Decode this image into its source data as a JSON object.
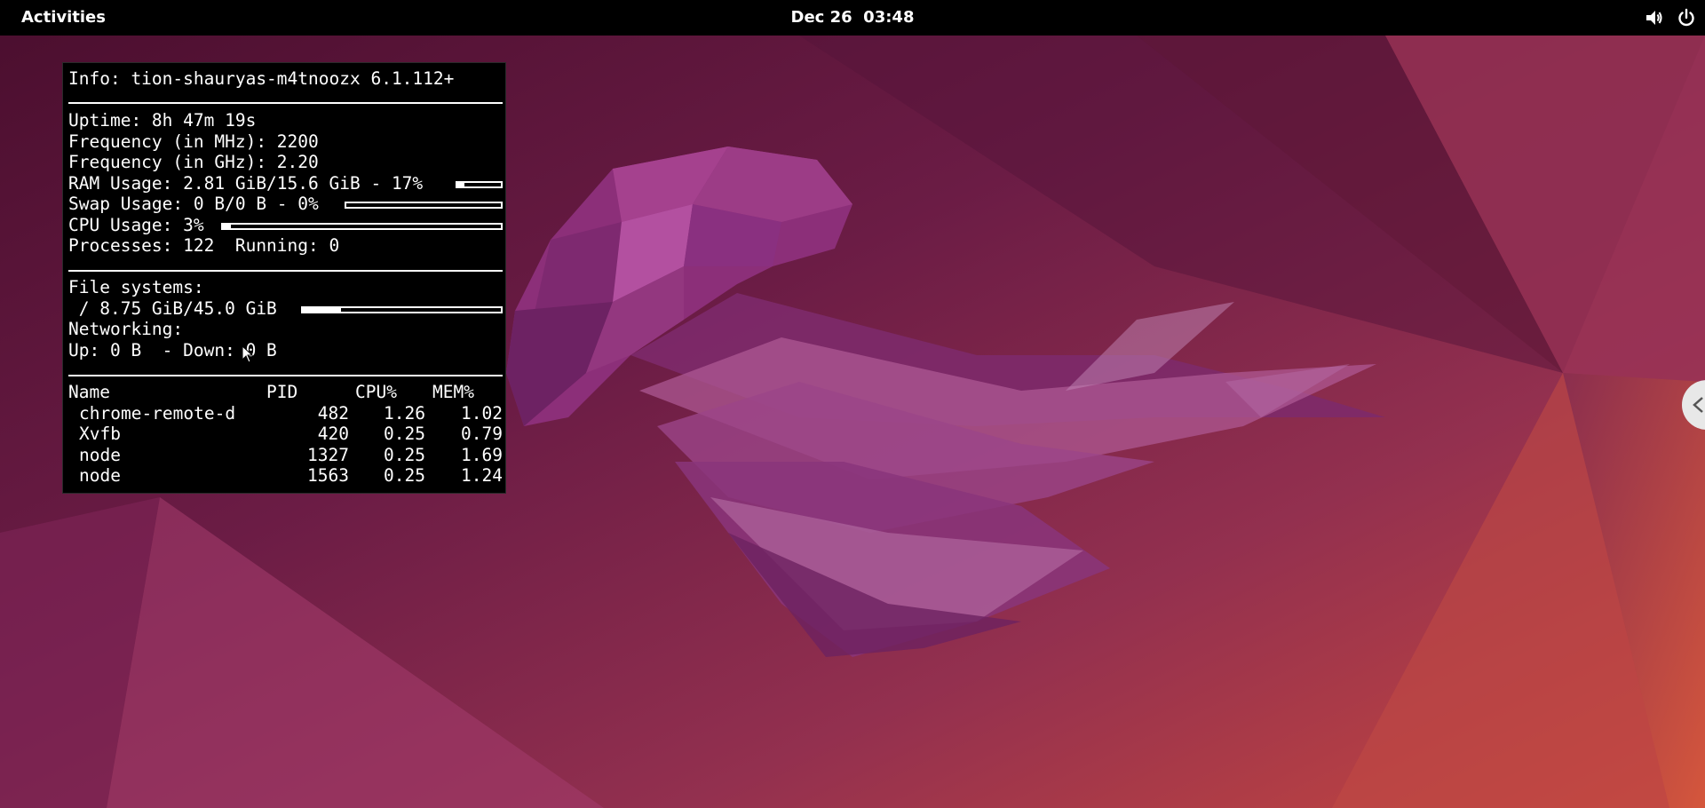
{
  "topbar": {
    "activities_label": "Activities",
    "clock_text": "Dec 26  03:48",
    "volume_icon": "volume-icon",
    "power_icon": "power-icon"
  },
  "conky": {
    "info": "Info: tion-shauryas-m4tnoozx 6.1.112+",
    "uptime": "Uptime: 8h 47m 19s",
    "freq_mhz": "Frequency (in MHz): 2200",
    "freq_ghz": "Frequency (in GHz): 2.20",
    "ram_usage": "RAM Usage: 2.81 GiB/15.6 GiB - 17%",
    "ram_fraction": 0.17,
    "swap_usage": "Swap Usage: 0 B/0 B - 0%",
    "swap_fraction": 0.0,
    "cpu_usage": "CPU Usage: 3%",
    "cpu_fraction": 0.03,
    "processes": "Processes: 122  Running: 0",
    "filesystems_label": "File systems:",
    "fs_root": " / 8.75 GiB/45.0 GiB",
    "fs_fraction": 0.194,
    "networking_label": "Networking:",
    "network": "Up: 0 B  - Down: 0 B",
    "process_headers": {
      "name": "Name",
      "pid": "PID",
      "cpu": "CPU%",
      "mem": "MEM%"
    },
    "process_rows": [
      {
        "name": "chrome-remote-d",
        "pid": "482",
        "cpu": "1.26",
        "mem": "1.02"
      },
      {
        "name": "Xvfb",
        "pid": "420",
        "cpu": "0.25",
        "mem": "0.79"
      },
      {
        "name": "node",
        "pid": "1327",
        "cpu": "0.25",
        "mem": "1.69"
      },
      {
        "name": "node",
        "pid": "1563",
        "cpu": "0.25",
        "mem": "1.24"
      }
    ]
  },
  "colors": {
    "panel_bg": "#000000",
    "text": "#ffffff",
    "wallpaper_base": "#6a1a44",
    "wallpaper_accent": "#d0503e"
  }
}
